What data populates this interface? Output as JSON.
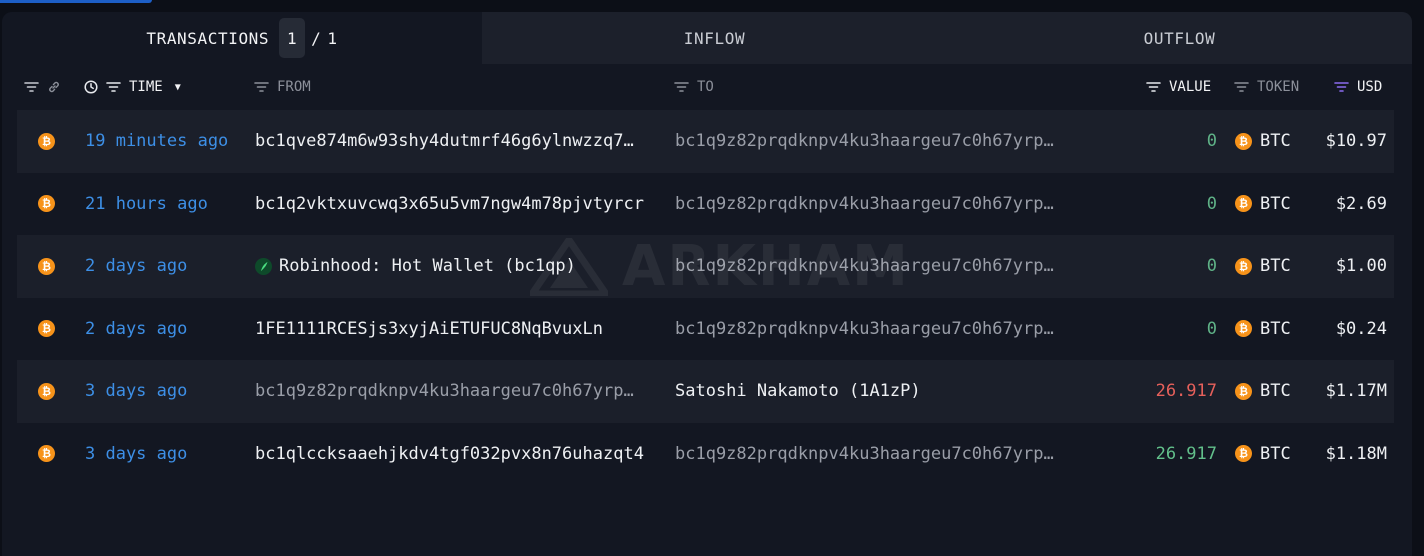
{
  "tabs": {
    "transactions_label": "TRANSACTIONS",
    "page_current": "1",
    "page_separator": "/",
    "page_total": "1",
    "inflow_label": "INFLOW",
    "outflow_label": "OUTFLOW"
  },
  "columns": {
    "time": "TIME",
    "from": "FROM",
    "to": "TO",
    "value": "VALUE",
    "token": "TOKEN",
    "usd": "USD"
  },
  "watermark": "ARKHAM",
  "colors": {
    "accent_blue": "#3d8fe6",
    "btc_orange": "#f7931a",
    "value_green": "#62c08b",
    "value_red": "#e6605b",
    "usd_filter_purple": "#8b6cf0"
  },
  "rows": [
    {
      "chain_icon": "bitcoin-icon",
      "time": "19 minutes ago",
      "from": "bc1qve874m6w93shy4dutmrf46g6ylnwzzq7…",
      "to": "bc1q9z82prqdknpv4ku3haargeu7c0h67yrp…",
      "value": "0",
      "token": "BTC",
      "usd": "$10.97"
    },
    {
      "chain_icon": "bitcoin-icon",
      "time": "21 hours ago",
      "from": "bc1q2vktxuvcwq3x65u5vm7ngw4m78pjvtyrcr",
      "to": "bc1q9z82prqdknpv4ku3haargeu7c0h67yrp…",
      "value": "0",
      "token": "BTC",
      "usd": "$2.69"
    },
    {
      "chain_icon": "bitcoin-icon",
      "time": "2 days ago",
      "from": "Robinhood: Hot Wallet (bc1qp)",
      "from_icon": "robinhood-icon",
      "to": "bc1q9z82prqdknpv4ku3haargeu7c0h67yrp…",
      "value": "0",
      "token": "BTC",
      "usd": "$1.00"
    },
    {
      "chain_icon": "bitcoin-icon",
      "time": "2 days ago",
      "from": "1FE1111RCESjs3xyjAiETUFUC8NqBvuxLn",
      "to": "bc1q9z82prqdknpv4ku3haargeu7c0h67yrp…",
      "value": "0",
      "token": "BTC",
      "usd": "$0.24"
    },
    {
      "chain_icon": "bitcoin-icon",
      "time": "3 days ago",
      "from": "bc1q9z82prqdknpv4ku3haargeu7c0h67yrp…",
      "to": "Satoshi Nakamoto (1A1zP)",
      "value": "26.917",
      "token": "BTC",
      "usd": "$1.17M"
    },
    {
      "chain_icon": "bitcoin-icon",
      "time": "3 days ago",
      "from": "bc1qlccksaaehjkdv4tgf032pvx8n76uhazqt4",
      "to": "bc1q9z82prqdknpv4ku3haargeu7c0h67yrp…",
      "value": "26.917",
      "token": "BTC",
      "usd": "$1.18M"
    }
  ]
}
